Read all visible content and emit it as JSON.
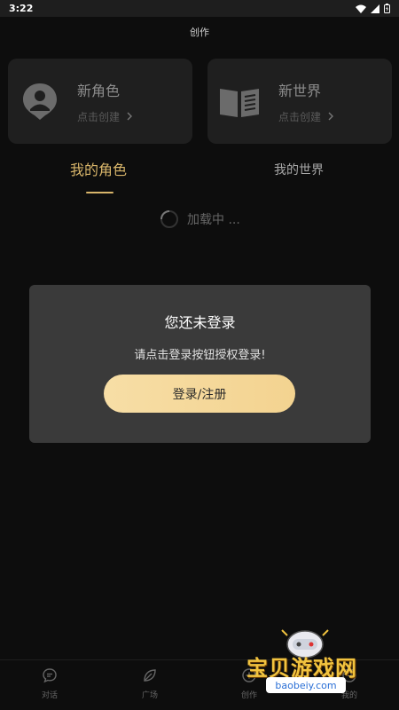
{
  "status_bar": {
    "time": "3:22"
  },
  "header": {
    "title": "创作"
  },
  "cards": [
    {
      "title": "新角色",
      "subtitle": "点击创建",
      "icon": "user-location-icon"
    },
    {
      "title": "新世界",
      "subtitle": "点击创建",
      "icon": "book-icon"
    }
  ],
  "tabs": [
    {
      "label": "我的角色",
      "active": true
    },
    {
      "label": "我的世界",
      "active": false
    }
  ],
  "loading_text": "加载中 ...",
  "dialog": {
    "title": "您还未登录",
    "message": "请点击登录按钮授权登录!",
    "button_label": "登录/注册"
  },
  "bottom_nav": [
    {
      "label": "对话",
      "icon": "chat-icon"
    },
    {
      "label": "广场",
      "icon": "leaf-icon"
    },
    {
      "label": "创作",
      "icon": "create-icon"
    },
    {
      "label": "我的",
      "icon": "profile-icon"
    }
  ],
  "watermark": {
    "text": "宝贝游戏网",
    "url": "baobeiy.com"
  },
  "colors": {
    "accent": "#d8b56a",
    "button": "#f5d99c",
    "dialog_bg": "#3a3a3a"
  }
}
